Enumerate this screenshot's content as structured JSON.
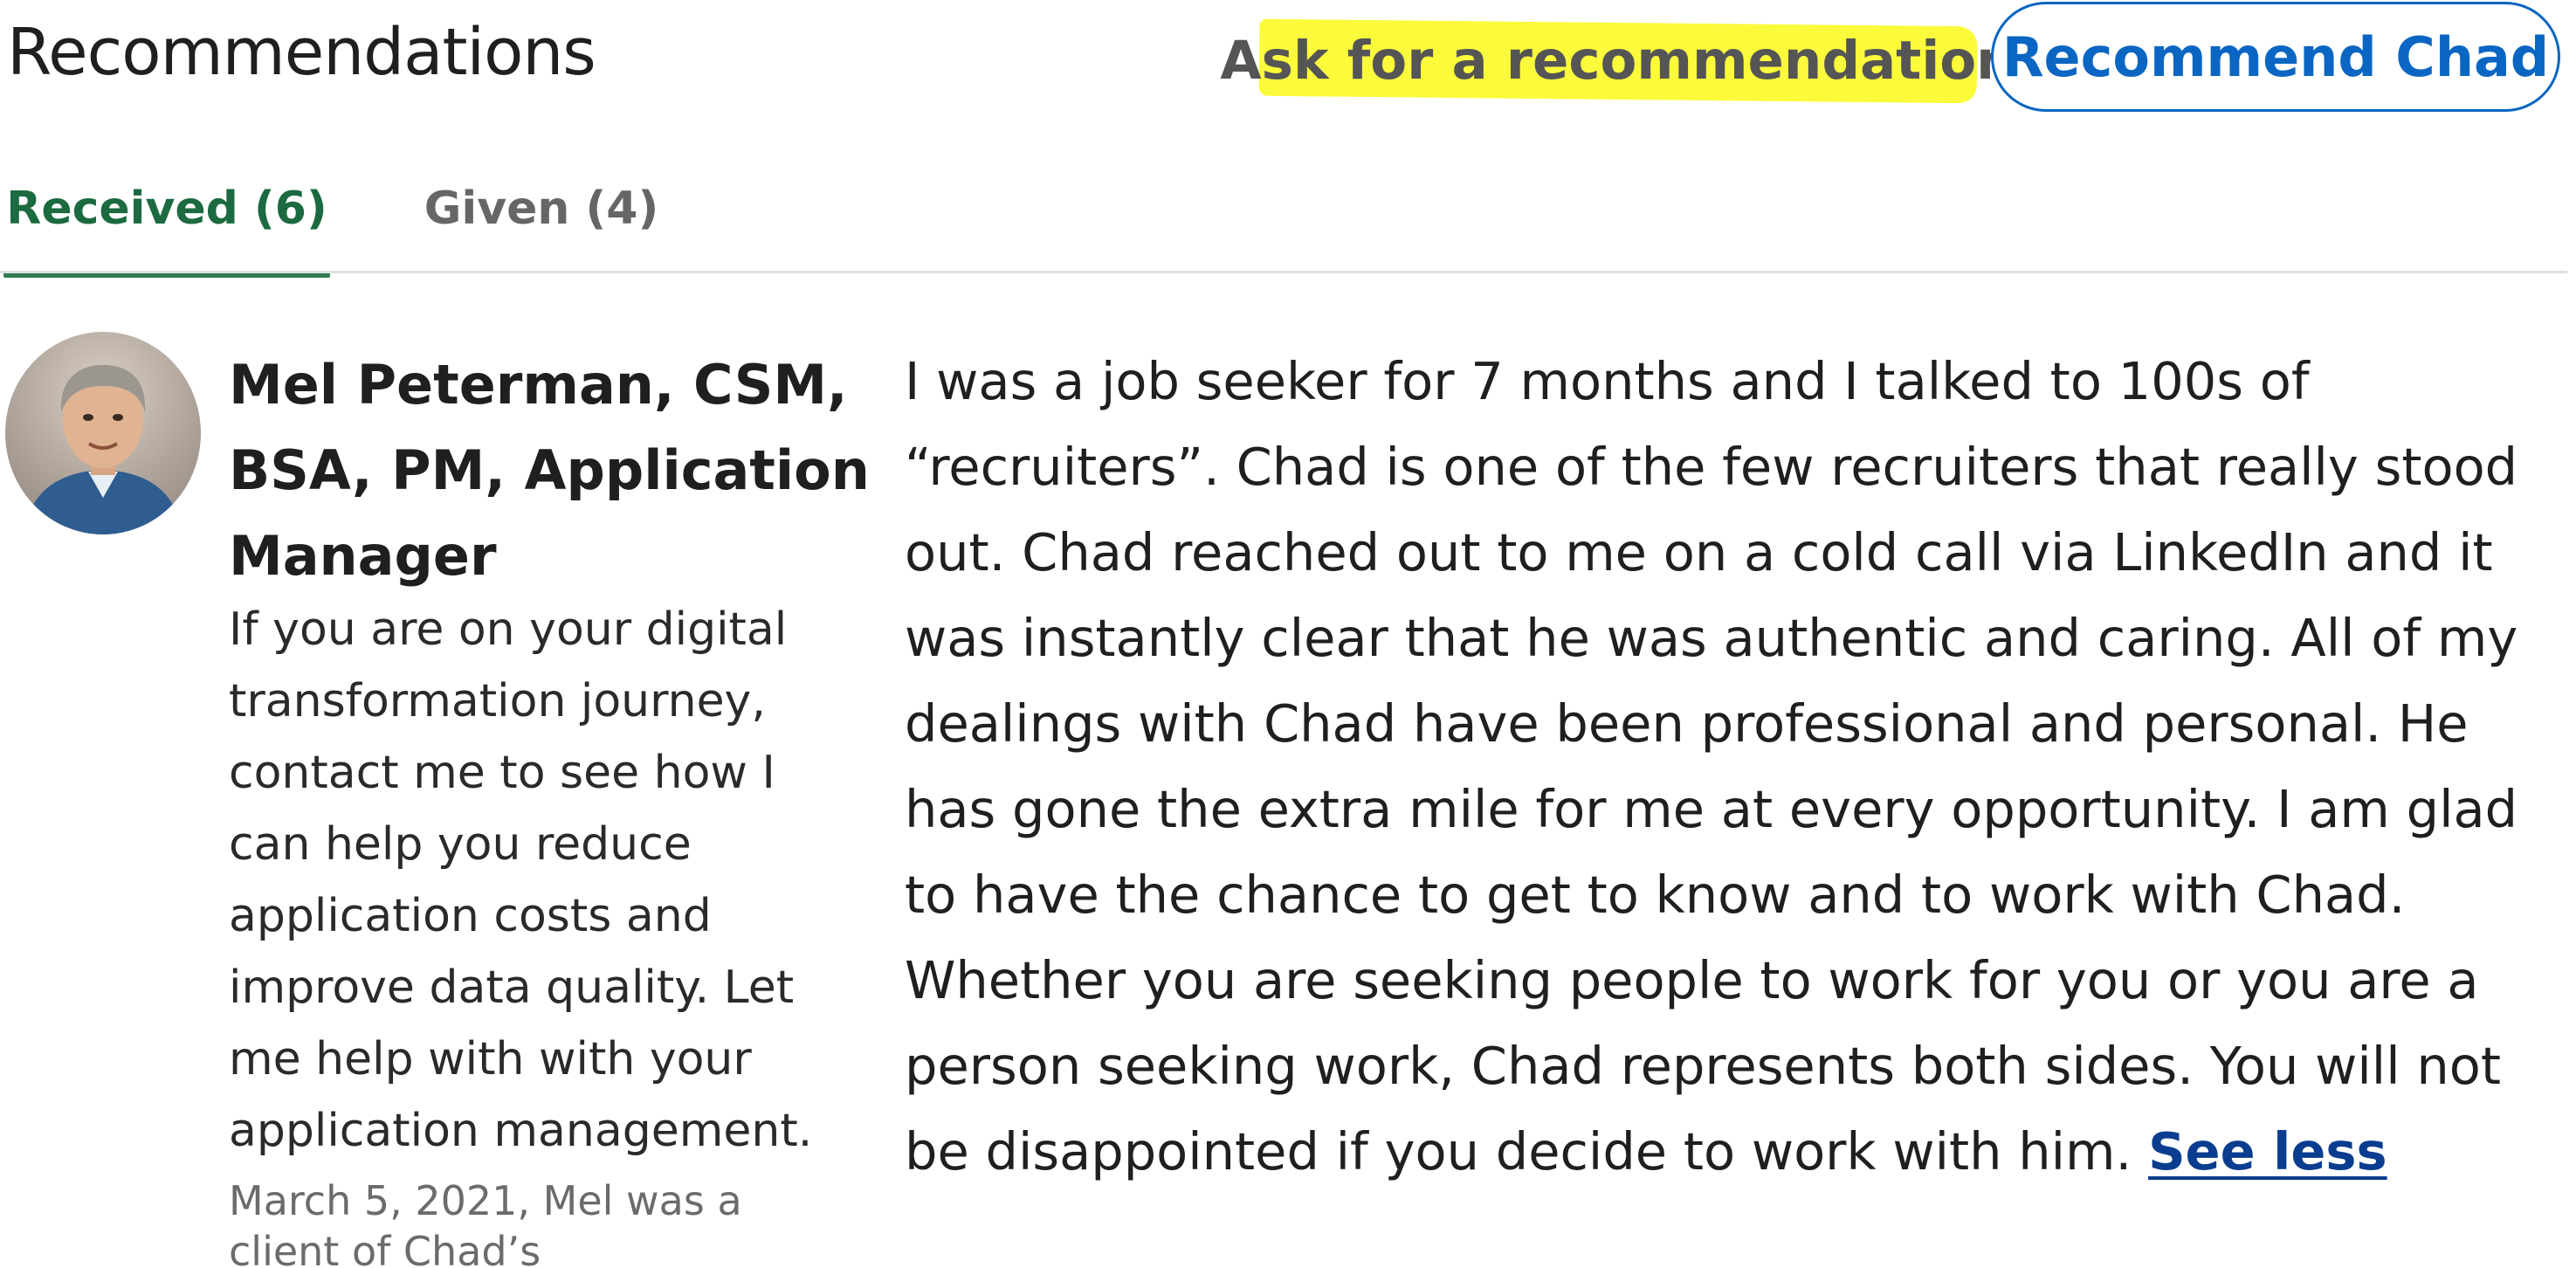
{
  "header": {
    "title": "Recommendations",
    "ask_link": "Ask for a recommendation",
    "recommend_button": "Recommend Chad"
  },
  "tabs": [
    {
      "label": "Received (6)",
      "active": true
    },
    {
      "label": "Given (4)",
      "active": false
    }
  ],
  "recommendation": {
    "author": "Mel Peterman, CSM, BSA, PM, Application Manager",
    "headline": "If you are on your digital transformation journey, contact me to see how I can help you reduce application costs and improve data quality. Let me help with with your application management.",
    "meta": "March 5, 2021, Mel was a client of Chad’s",
    "text": "I was a job seeker for 7 months and I talked to 100s of “recruiters”. Chad is one of the few recruiters that really stood out. Chad reached out to me on a cold call via LinkedIn and it was instantly clear that he was authentic and caring. All of my dealings with Chad have been professional and personal. He has gone the extra mile for me at every opportunity. I am glad to have the chance to get to know and to work with Chad. Whether you are seeking people to work for you or you are a person seeking work, Chad represents both sides. You will not be disappointed if you decide to work with him.",
    "see_less": "See less"
  },
  "colors": {
    "brand_blue": "#0a66c2",
    "active_tab_green": "#1c6a40",
    "highlight_yellow": "#fbfb3c"
  }
}
